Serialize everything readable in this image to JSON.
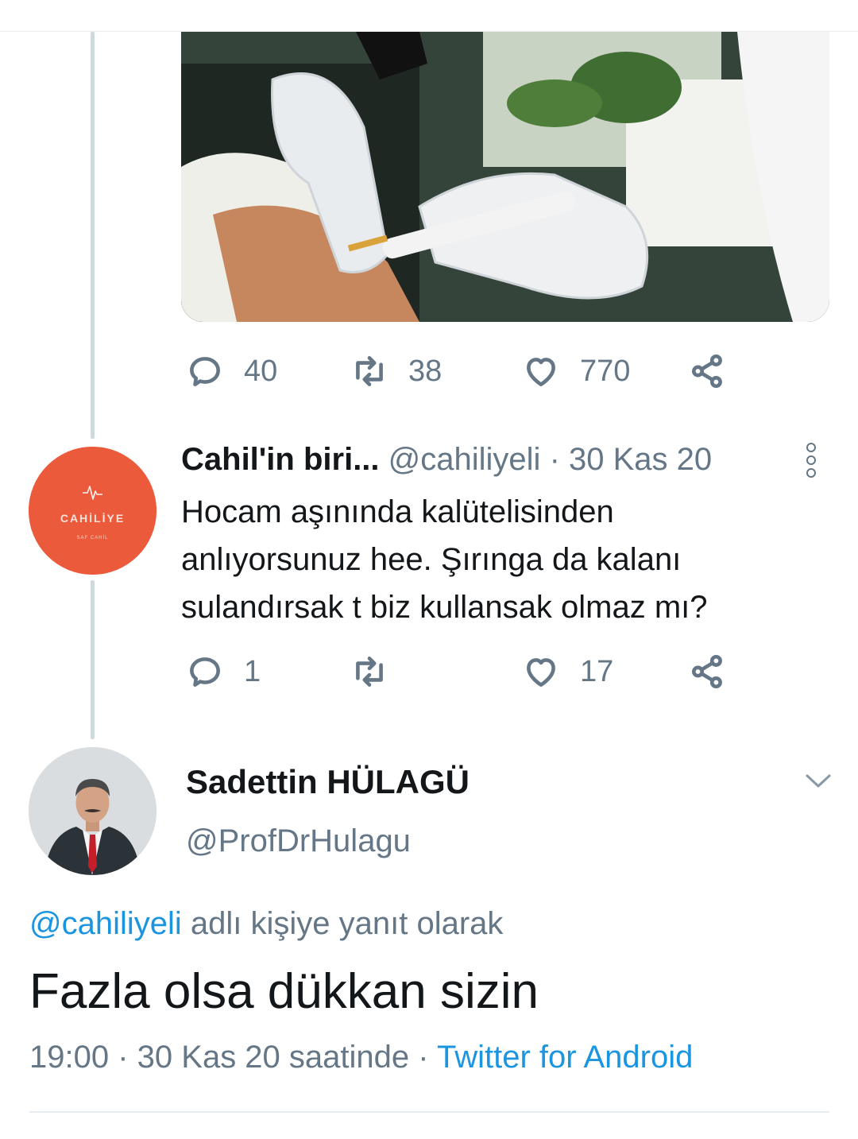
{
  "tweet1": {
    "actions": {
      "reply_count": "40",
      "retweet_count": "38",
      "like_count": "770"
    }
  },
  "tweet2": {
    "display_name": "Cahil'in biri...",
    "handle": "@cahiliyeli",
    "separator": "·",
    "date": "30 Kas 20",
    "text_lines": [
      "Hocam aşınında kalütelisinden",
      "anlıyorsunuz hee. Şırınga da kalanı",
      "sulandırsak t biz kullansak olmaz mı?"
    ],
    "avatar_logo_text": "CAHİLİYE",
    "avatar_logo_sub": "SAF CAHİL",
    "avatar_color": "#ec5a3c",
    "actions": {
      "reply_count": "1",
      "retweet_count": "",
      "like_count": "17"
    }
  },
  "main_tweet": {
    "display_name": "Sadettin HÜLAGÜ",
    "handle": "@ProfDrHulagu",
    "reply_to_handle": "@cahiliyeli",
    "reply_to_suffix": " adlı kişiye yanıt olarak",
    "text": "Fazla olsa dükkan sizin",
    "time": "19:00",
    "meta_middle": " · 30 Kas 20 saatinde · ",
    "source": "Twitter for Android"
  },
  "colors": {
    "link": "#1b95e0",
    "muted": "#657786",
    "thread_line": "#cfd9de",
    "divider": "#e6ecf0"
  }
}
